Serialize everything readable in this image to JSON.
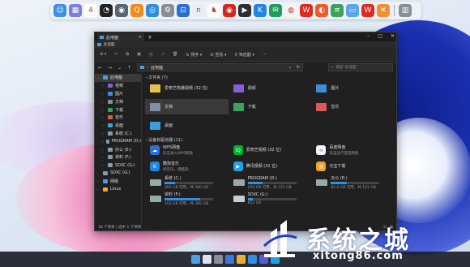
{
  "dock": {
    "apps": [
      {
        "icon": "finder-icon",
        "color": "#3b8fe8",
        "glyph": "☺"
      },
      {
        "icon": "launchpad-icon",
        "color": "#7a7fe0",
        "glyph": "▦"
      },
      {
        "icon": "calendar-icon",
        "color": "#ffffff",
        "glyph": "4"
      },
      {
        "icon": "clock-icon",
        "color": "#222222",
        "glyph": "◔"
      },
      {
        "icon": "photo-icon",
        "color": "#556677",
        "glyph": "◉"
      },
      {
        "icon": "search-app-icon",
        "color": "#f08a1a",
        "glyph": "Q"
      },
      {
        "icon": "safari-icon",
        "color": "#2f8fe0",
        "glyph": "◎"
      },
      {
        "icon": "settings-icon",
        "color": "#8a8f96",
        "glyph": "⚙"
      },
      {
        "icon": "remote-desktop-icon",
        "color": "#2b6ed2",
        "glyph": "⊡"
      },
      {
        "icon": "nfs-icon",
        "color": "#e8eef6",
        "glyph": "n"
      },
      {
        "icon": "qq-icon",
        "color": "#ffffff",
        "glyph": "♞"
      },
      {
        "icon": "netease-music-icon",
        "color": "#d9241b",
        "glyph": "◉"
      },
      {
        "icon": "video-player-icon",
        "color": "#2f2f2f",
        "glyph": "▶"
      },
      {
        "icon": "kugou-icon",
        "color": "#1f86e8",
        "glyph": "K"
      },
      {
        "icon": "chat-icon",
        "color": "#1e9e5a",
        "glyph": "✉"
      },
      {
        "icon": "weibo-icon",
        "color": "#f4f4f4",
        "glyph": "◍"
      },
      {
        "icon": "wps-icon",
        "color": "#e02a1f",
        "glyph": "W"
      },
      {
        "icon": "browser-icon",
        "color": "#f05a28",
        "glyph": "◐"
      },
      {
        "icon": "files-icon",
        "color": "#3ba35a",
        "glyph": "≡"
      },
      {
        "icon": "folder-icon",
        "color": "#5aa6e8",
        "glyph": "▭"
      },
      {
        "icon": "wps-office-icon",
        "color": "#e02a1f",
        "glyph": "W"
      },
      {
        "icon": "orange-app-icon",
        "color": "#f19030",
        "glyph": "✕"
      },
      {
        "icon": "trash-icon",
        "color": "#8a9098",
        "glyph": "▥"
      }
    ]
  },
  "window": {
    "tab_title": "此电脑",
    "address_title": "此电脑",
    "cmd": {
      "sort": "排序",
      "view": "查看",
      "filter": "筛选器"
    },
    "path": "此电脑",
    "search_placeholder": "搜索\"此电脑\"",
    "sidebar": [
      {
        "label": "此电脑",
        "color": "#4aa0e0",
        "selected": true,
        "indent": 1
      },
      {
        "label": "视频",
        "color": "#8a5cd6",
        "indent": 2
      },
      {
        "label": "图片",
        "color": "#3a8fd8",
        "indent": 2
      },
      {
        "label": "文档",
        "color": "#7f8fa6",
        "indent": 2
      },
      {
        "label": "下载",
        "color": "#3aa35a",
        "indent": 2
      },
      {
        "label": "音乐",
        "color": "#e0565a",
        "indent": 2
      },
      {
        "label": "桌面",
        "color": "#3aa0d8",
        "indent": 2
      },
      {
        "label": "系统 (C:)",
        "color": "#8a9aa8",
        "indent": 2
      },
      {
        "label": "PROGRAM (D:)",
        "color": "#8a9aa8",
        "indent": 2
      },
      {
        "label": "办公 (E:)",
        "color": "#8a9aa8",
        "indent": 2
      },
      {
        "label": "资料 (F:)",
        "color": "#8a9aa8",
        "indent": 2
      },
      {
        "label": "SDXC (G:)",
        "color": "#8a9aa8",
        "indent": 2
      },
      {
        "label": "SDXC (G:)",
        "color": "#8a9aa8",
        "indent": 1
      },
      {
        "label": "网络",
        "color": "#4aa0e0",
        "indent": 1
      },
      {
        "label": "Linux",
        "color": "#e8b030",
        "indent": 1
      }
    ],
    "folders_header": "文件夹 (7)",
    "folders": [
      {
        "label": "爱奇艺热播视频 (32 位)",
        "color": "#e8c04a"
      },
      {
        "label": "视频",
        "color": "#8a5cd6"
      },
      {
        "label": "图片",
        "color": "#3a8fd8"
      },
      {
        "label": "文档",
        "color": "#7f8fa6",
        "selected": true
      },
      {
        "label": "下载",
        "color": "#3aa35a"
      },
      {
        "label": "音乐",
        "color": "#e0565a"
      },
      {
        "label": "桌面",
        "color": "#3aa0d8"
      }
    ],
    "devices_header": "设备和驱动器 (11)",
    "devices": [
      {
        "icon": "wps-cloud-icon",
        "color": "#2f6fd8",
        "glyph": "☁",
        "name": "WPS网盘",
        "sub": "双击进入WPS网盘"
      },
      {
        "icon": "iqiyi-icon",
        "color": "#00b42a",
        "glyph": "iQ",
        "name": "爱奇艺视频 (32 位)",
        "sub": ""
      },
      {
        "icon": "baidu-netdisk-icon",
        "color": "#f0f4fa",
        "glyph": "∞",
        "name": "百度网盘",
        "sub": "双击运行百度网盘"
      },
      {
        "icon": "kugou-music-icon",
        "color": "#1f86e8",
        "glyph": "K",
        "name": "酷狗音乐",
        "sub": "听音乐，用酷狗"
      },
      {
        "icon": "tencent-video-icon",
        "color": "#1fa0e8",
        "glyph": "▶",
        "name": "腾讯视频 (32 位)",
        "sub": ""
      },
      {
        "icon": "tencent-docs-icon",
        "color": "#f0a030",
        "glyph": "▤",
        "name": "元宝下载",
        "sub": ""
      },
      {
        "drive": true,
        "name": "系统 (C:)",
        "sub": "392 GB 可用，共 500 GB",
        "fill": 0.22
      },
      {
        "drive": true,
        "name": "PROGRAM (D:)",
        "sub": "259 GB 可用，共 372 GB",
        "fill": 0.3
      },
      {
        "drive": true,
        "name": "办公 (E:)",
        "sub": "81.6 GB 可用，共 121 GB",
        "fill": 0.33
      },
      {
        "drive": true,
        "name": "资料 (F:)",
        "sub": "101 GB 可用，共 385 GB",
        "fill": 0.74
      },
      {
        "drive": true,
        "sdxc": true,
        "name": "SDXC (G:)",
        "sub": "852 GB",
        "fill": 0.1
      }
    ],
    "status": "18 个项目 | 选中 1 个项目"
  },
  "watermark": {
    "title": "系统之城",
    "url": "xitong86.com"
  }
}
